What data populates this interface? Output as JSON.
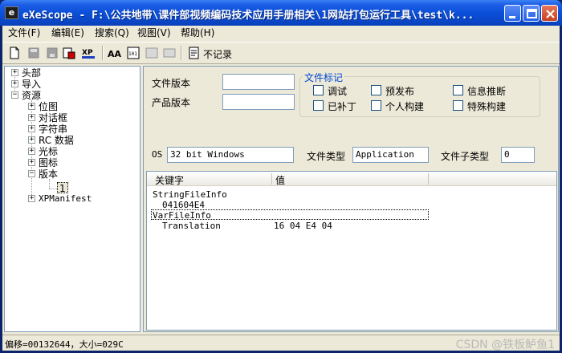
{
  "window": {
    "title": "eXeScope - F:\\公共地带\\课件部视频编码技术应用手册相关\\1网站打包运行工具\\test\\k..."
  },
  "menu": [
    {
      "label": "文件(F)"
    },
    {
      "label": "编辑(E)"
    },
    {
      "label": "搜索(Q)"
    },
    {
      "label": "视图(V)"
    },
    {
      "label": "帮助(H)"
    }
  ],
  "toolbar": {
    "no_record_label": "不记录"
  },
  "tree": {
    "items": [
      {
        "label": "头部"
      },
      {
        "label": "导入"
      },
      {
        "label": "资源"
      },
      {
        "label": "位图"
      },
      {
        "label": "对话框"
      },
      {
        "label": "字符串"
      },
      {
        "label": "RC 数据"
      },
      {
        "label": "光标"
      },
      {
        "label": "图标"
      },
      {
        "label": "版本"
      },
      {
        "label": "1"
      },
      {
        "label": "XPManifest"
      }
    ]
  },
  "version": {
    "file_version_label": "文件版本",
    "file_version_value": "",
    "product_version_label": "产品版本",
    "product_version_value": "",
    "flags_title": "文件标记",
    "flags": [
      {
        "label": "调试",
        "checked": false
      },
      {
        "label": "预发布",
        "checked": false
      },
      {
        "label": "信息推断",
        "checked": false
      },
      {
        "label": "已补丁",
        "checked": false
      },
      {
        "label": "个人构建",
        "checked": false
      },
      {
        "label": "特殊构建",
        "checked": false
      }
    ],
    "os_label": "OS",
    "os_value": "32 bit Windows",
    "file_type_label": "文件类型",
    "file_type_value": "Application",
    "file_subtype_label": "文件子类型",
    "file_subtype_value": "0"
  },
  "list": {
    "columns": [
      "关键字",
      "值"
    ],
    "rows": [
      {
        "key": "StringFileInfo",
        "value": ""
      },
      {
        "key": "041604E4",
        "value": ""
      },
      {
        "key": "VarFileInfo",
        "value": ""
      },
      {
        "key": "Translation",
        "value": "16 04 E4 04"
      }
    ]
  },
  "status": {
    "text": "偏移=00132644，大小=029C",
    "watermark": "CSDN @铁板鲈鱼1"
  },
  "colors": {
    "title_bar": "#0b4fd8",
    "face": "#ece9d8",
    "group_title": "#0046d5"
  }
}
